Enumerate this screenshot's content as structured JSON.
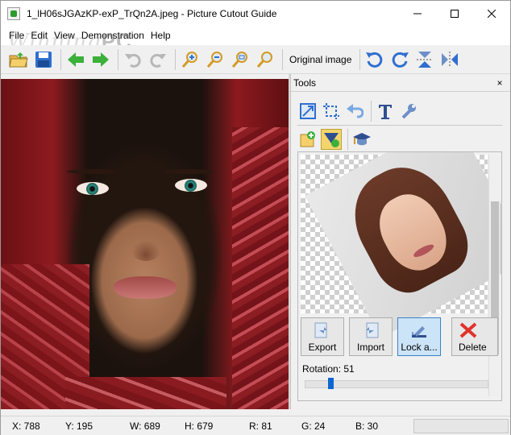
{
  "window": {
    "title": "1_lH06sJGAzKP-exP_TrQn2A.jpeg - Picture Cutout Guide",
    "watermark": "Winning",
    "watermark_suffix": "PC"
  },
  "menu": [
    "File",
    "Edit",
    "View",
    "Demonstration",
    "Help"
  ],
  "toolbar": {
    "icons": [
      "open-icon",
      "save-icon",
      "back-arrow-icon",
      "forward-arrow-icon",
      "undo-icon",
      "redo-icon",
      "zoom-in-icon",
      "zoom-out-icon",
      "zoom-fit-icon",
      "zoom-actual-icon",
      "rotate-left-icon",
      "rotate-right-icon",
      "flip-vertical-icon",
      "flip-horizontal-icon"
    ],
    "original_image_label": "Original image"
  },
  "tools_panel": {
    "title": "Tools",
    "close_label": "×",
    "rotation_label": "Rotation: 51",
    "rotation_value": 51,
    "rotation_fraction": 0.14,
    "buttons": {
      "export": "Export",
      "import": "Import",
      "lock": "Lock a...",
      "delete": "Delete"
    }
  },
  "status": {
    "x": "X: 788",
    "y": "Y: 195",
    "w": "W: 689",
    "h": "H: 679",
    "r": "R: 81",
    "g": "G: 24",
    "b": "B: 30"
  },
  "colors": {
    "accent": "#0c66d2",
    "toolbar_green": "#3bb03b",
    "toolbar_blue": "#2f6fcf",
    "selected_tool": "#f3d56b"
  }
}
